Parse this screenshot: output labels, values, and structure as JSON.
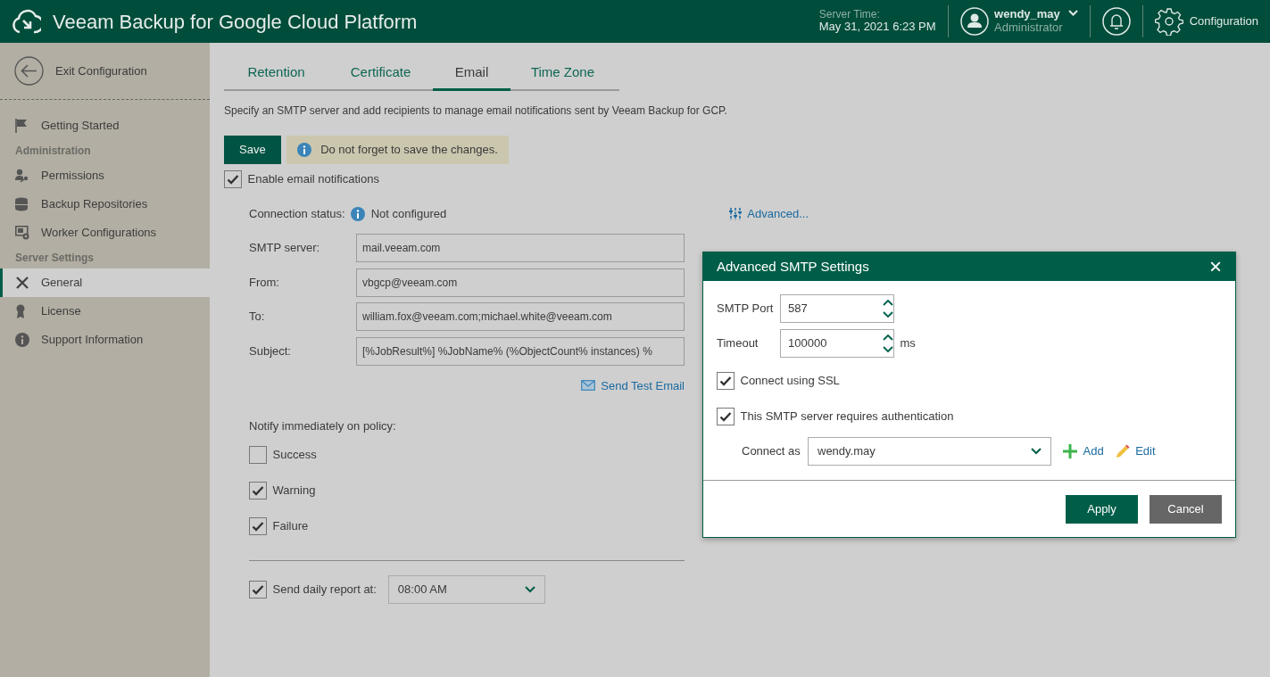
{
  "header": {
    "title": "Veeam Backup for Google Cloud Platform",
    "server_time_label": "Server Time:",
    "server_time": "May 31, 2021 6:23 PM",
    "user": "wendy_may",
    "role": "Administrator",
    "configuration": "Configuration"
  },
  "sidebar": {
    "exit": "Exit Configuration",
    "items": [
      {
        "kind": "item",
        "label": "Getting Started",
        "selected": false
      },
      {
        "kind": "section",
        "label": "Administration"
      },
      {
        "kind": "item",
        "label": "Permissions",
        "selected": false
      },
      {
        "kind": "item",
        "label": "Backup Repositories",
        "selected": false
      },
      {
        "kind": "item",
        "label": "Worker Configurations",
        "selected": false
      },
      {
        "kind": "section",
        "label": "Server Settings"
      },
      {
        "kind": "item",
        "label": "General",
        "selected": true
      },
      {
        "kind": "item",
        "label": "License",
        "selected": false
      },
      {
        "kind": "item",
        "label": "Support Information",
        "selected": false
      }
    ]
  },
  "tabs": [
    {
      "label": "Retention",
      "selected": false
    },
    {
      "label": "Certificate",
      "selected": false
    },
    {
      "label": "Email",
      "selected": true
    },
    {
      "label": "Time Zone",
      "selected": false
    }
  ],
  "description": "Specify an SMTP server and add recipients to manage email notifications sent by Veeam Backup for GCP.",
  "save_button": "Save",
  "notice": "Do not forget to save the changes.",
  "enable": {
    "label": "Enable email notifications",
    "checked": true
  },
  "connection_status": {
    "label": "Connection status:",
    "value": "Not configured"
  },
  "advanced_link": "Advanced...",
  "fields": [
    {
      "label": "SMTP server:",
      "value": "mail.veeam.com"
    },
    {
      "label": "From:",
      "value": "vbgcp@veeam.com"
    },
    {
      "label": "To:",
      "value": "william.fox@veeam.com;michael.white@veeam.com"
    },
    {
      "label": "Subject:",
      "value": "[%JobResult%] %JobName% (%ObjectCount% instances) %"
    }
  ],
  "send_test": "Send Test Email",
  "notify": {
    "label": "Notify immediately on policy:",
    "options": [
      {
        "label": "Success",
        "checked": false
      },
      {
        "label": "Warning",
        "checked": true
      },
      {
        "label": "Failure",
        "checked": true
      }
    ]
  },
  "daily_report": {
    "label": "Send daily report at:",
    "checked": true,
    "time": "08:00 AM"
  },
  "dialog": {
    "title": "Advanced SMTP Settings",
    "close": "×",
    "port_label": "SMTP Port",
    "port": "587",
    "timeout_label": "Timeout",
    "timeout": "100000",
    "timeout_unit": "ms",
    "options": [
      {
        "label": "Connect using SSL",
        "checked": true
      },
      {
        "label": "This SMTP server requires authentication",
        "checked": true
      }
    ],
    "connect_as_label": "Connect as",
    "connect_as": "wendy.may",
    "add": "Add",
    "edit": "Edit",
    "apply": "Apply",
    "cancel": "Cancel"
  }
}
